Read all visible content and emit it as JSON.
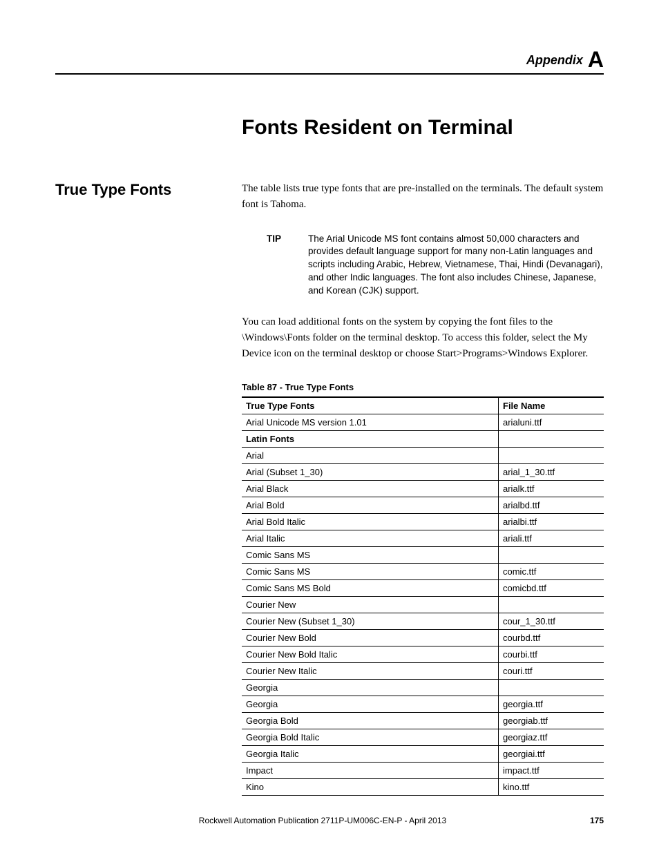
{
  "header": {
    "appendix_word": "Appendix",
    "appendix_letter": "A"
  },
  "chapter_title": "Fonts Resident on Terminal",
  "side_heading": "True Type Fonts",
  "intro_para1": "The table lists true type fonts that are pre-installed on the terminals. The default system font is Tahoma.",
  "tip": {
    "label": "TIP",
    "text": "The Arial Unicode MS font contains almost 50,000 characters and provides default language support for many non-Latin languages and scripts including Arabic, Hebrew, Vietnamese, Thai, Hindi (Devanagari), and other Indic languages. The font also includes Chinese, Japanese, and Korean (CJK) support."
  },
  "intro_para2": "You can load additional fonts on the system by copying the font files to the \\Windows\\Fonts folder on the terminal desktop. To access this folder, select the My Device icon on the terminal desktop or choose Start>Programs>Windows Explorer.",
  "table": {
    "caption": "Table 87 - True Type Fonts",
    "head": {
      "c1": "True Type Fonts",
      "c2": "File Name"
    },
    "rows": [
      {
        "name": "Arial Unicode MS version 1.01",
        "file": "arialuni.ttf",
        "indent": 0,
        "bold": false
      },
      {
        "name": "Latin Fonts",
        "file": "",
        "indent": 0,
        "bold": true
      },
      {
        "name": "Arial",
        "file": "",
        "indent": 0,
        "bold": false
      },
      {
        "name": "Arial (Subset 1_30)",
        "file": "arial_1_30.ttf",
        "indent": 1,
        "bold": false
      },
      {
        "name": "Arial Black",
        "file": "arialk.ttf",
        "indent": 1,
        "bold": false
      },
      {
        "name": "Arial Bold",
        "file": "arialbd.ttf",
        "indent": 1,
        "bold": false
      },
      {
        "name": "Arial Bold Italic",
        "file": "arialbi.ttf",
        "indent": 1,
        "bold": false
      },
      {
        "name": "Arial Italic",
        "file": "ariali.ttf",
        "indent": 1,
        "bold": false
      },
      {
        "name": "Comic Sans MS",
        "file": "",
        "indent": 0,
        "bold": false
      },
      {
        "name": "Comic Sans MS",
        "file": "comic.ttf",
        "indent": 1,
        "bold": false
      },
      {
        "name": "Comic Sans MS Bold",
        "file": "comicbd.ttf",
        "indent": 1,
        "bold": false
      },
      {
        "name": "Courier New",
        "file": "",
        "indent": 0,
        "bold": false
      },
      {
        "name": "Courier New (Subset 1_30)",
        "file": "cour_1_30.ttf",
        "indent": 1,
        "bold": false
      },
      {
        "name": "Courier New Bold",
        "file": "courbd.ttf",
        "indent": 1,
        "bold": false
      },
      {
        "name": "Courier New Bold Italic",
        "file": "courbi.ttf",
        "indent": 1,
        "bold": false
      },
      {
        "name": "Courier New Italic",
        "file": "couri.ttf",
        "indent": 1,
        "bold": false
      },
      {
        "name": "Georgia",
        "file": "",
        "indent": 0,
        "bold": false
      },
      {
        "name": "Georgia",
        "file": "georgia.ttf",
        "indent": 1,
        "bold": false
      },
      {
        "name": "Georgia Bold",
        "file": "georgiab.ttf",
        "indent": 1,
        "bold": false
      },
      {
        "name": "Georgia Bold Italic",
        "file": "georgiaz.ttf",
        "indent": 1,
        "bold": false
      },
      {
        "name": "Georgia Italic",
        "file": "georgiai.ttf",
        "indent": 1,
        "bold": false
      },
      {
        "name": "Impact",
        "file": "impact.ttf",
        "indent": 0,
        "bold": false
      },
      {
        "name": "Kino",
        "file": "kino.ttf",
        "indent": 0,
        "bold": false
      }
    ]
  },
  "footer": {
    "publication": "Rockwell Automation Publication 2711P-UM006C-EN-P - April 2013",
    "page": "175"
  }
}
